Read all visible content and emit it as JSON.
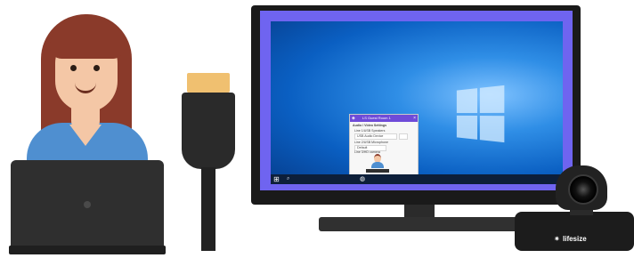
{
  "screen": {
    "app_window": {
      "title": "LS Guest Room 1",
      "section_heading": "Audio / Video Settings",
      "fields": [
        {
          "label": "Line 1/USB Speakers",
          "value": "USB Audio Device"
        },
        {
          "label": "Line 2/USB Microphone",
          "value": "Default"
        },
        {
          "label": "Line 3/HD camera",
          "value": ""
        }
      ]
    },
    "taskbar": {
      "start_glyph": "⊞",
      "search_glyph": "⌕",
      "app_glyph": "◍"
    }
  },
  "camera": {
    "brand": "lifesize",
    "brand_glyph": "✷"
  },
  "colors": {
    "screen_border": "#6f64f0",
    "shirt": "#4f8fd0",
    "hair": "#8a3a2a",
    "skin": "#f4c7a6",
    "hdmi_tip": "#f0c070",
    "app_titlebar": "#6f4bd8"
  },
  "icons": [
    "person-illustration",
    "laptop-icon",
    "hdmi-cable-icon",
    "windows-logo-icon",
    "camera-icon"
  ]
}
